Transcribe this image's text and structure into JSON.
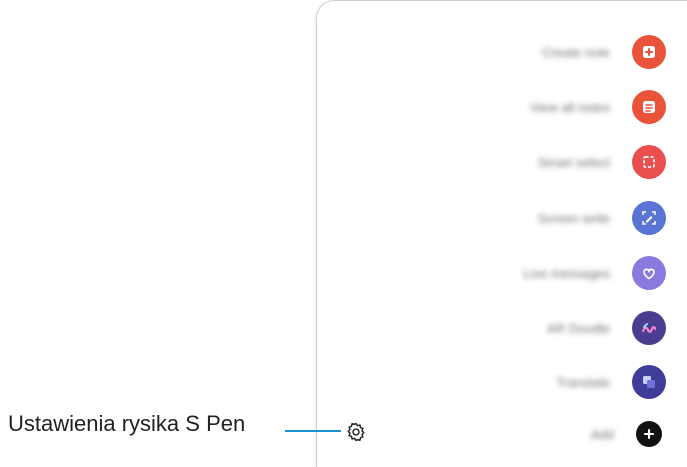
{
  "callout": {
    "label": "Ustawienia rysika S Pen"
  },
  "menu": {
    "items": [
      {
        "label": "Create note",
        "icon": "create-note-icon",
        "color": "#e8533a"
      },
      {
        "label": "View all notes",
        "icon": "view-notes-icon",
        "color": "#e8533a"
      },
      {
        "label": "Smart select",
        "icon": "smart-select-icon",
        "color": "#ea4f4f"
      },
      {
        "label": "Screen write",
        "icon": "screen-write-icon",
        "color": "#5a74d6"
      },
      {
        "label": "Live messages",
        "icon": "live-messages-icon",
        "color": "#8a7ae0"
      },
      {
        "label": "AR Doodle",
        "icon": "ar-doodle-icon",
        "color": "#4b3d8f"
      },
      {
        "label": "Translate",
        "icon": "translate-icon",
        "color": "#3f3d99"
      }
    ],
    "add": {
      "label": "Add",
      "icon": "add-icon",
      "color": "#111111"
    }
  },
  "settings": {
    "icon": "gear-icon"
  }
}
